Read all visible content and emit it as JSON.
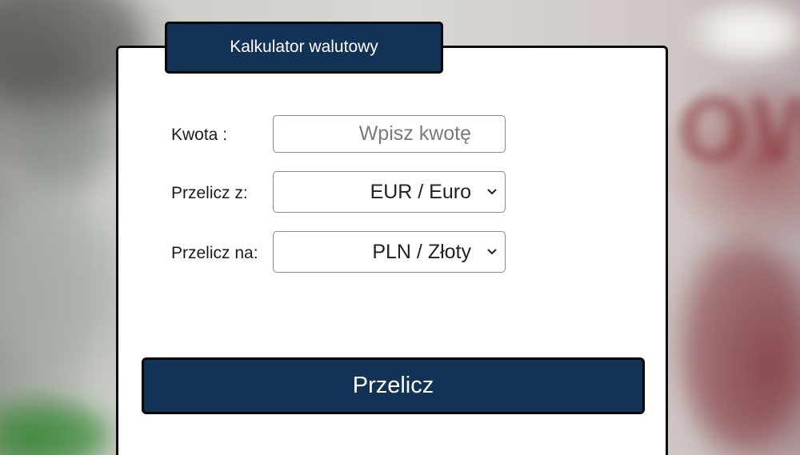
{
  "calculator": {
    "title": "Kalkulator walutowy",
    "amount": {
      "label": "Kwota :",
      "value": "",
      "placeholder": "Wpisz kwotę"
    },
    "from": {
      "label": "Przelicz z:",
      "selected": "EUR / Euro"
    },
    "to": {
      "label": "Przelicz na:",
      "selected": "PLN / Złoty"
    },
    "submit_label": "Przelicz"
  },
  "icons": {
    "select_arrow": "chevron-down-icon"
  },
  "colors": {
    "accent": "#123256",
    "card_background": "#ffffff",
    "border": "#0c0c0c"
  }
}
